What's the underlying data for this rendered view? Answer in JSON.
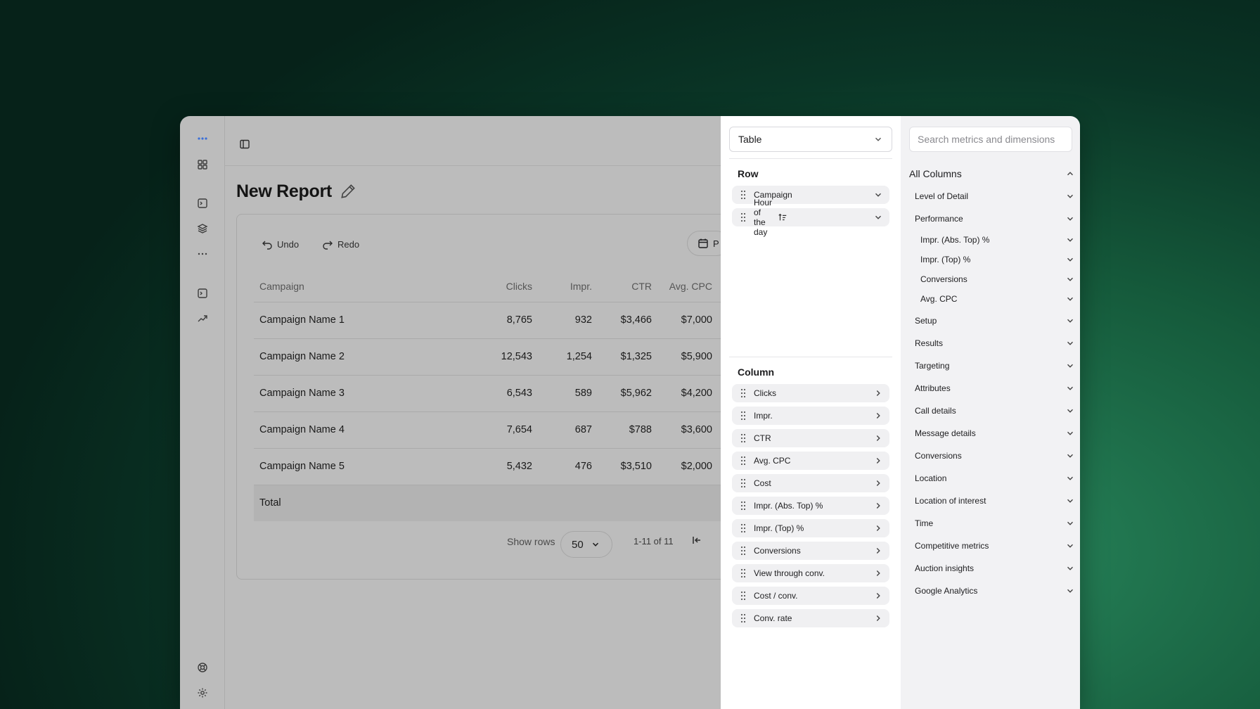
{
  "page": {
    "title": "New Report"
  },
  "toolbar": {
    "undo_label": "Undo",
    "redo_label": "Redo",
    "date_label": "P"
  },
  "table": {
    "headers": [
      "Campaign",
      "Clicks",
      "Impr.",
      "CTR",
      "Avg. CPC"
    ],
    "rows": [
      [
        "Campaign Name 1",
        "8,765",
        "932",
        "$3,466",
        "$7,000"
      ],
      [
        "Campaign Name 2",
        "12,543",
        "1,254",
        "$1,325",
        "$5,900"
      ],
      [
        "Campaign Name 3",
        "6,543",
        "589",
        "$5,962",
        "$4,200"
      ],
      [
        "Campaign Name 4",
        "7,654",
        "687",
        "$788",
        "$3,600"
      ],
      [
        "Campaign Name 5",
        "5,432",
        "476",
        "$3,510",
        "$2,000"
      ]
    ],
    "total_label": "Total"
  },
  "pagination": {
    "show_rows_label": "Show rows",
    "rows_value": "50",
    "range_text": "1-11 of 11"
  },
  "config": {
    "chart_type": "Table",
    "row_section_title": "Row",
    "row_items": [
      "Campaign",
      "Hour of the day"
    ],
    "column_section_title": "Column",
    "column_items": [
      "Clicks",
      "Impr.",
      "CTR",
      "Avg. CPC",
      "Cost",
      "Impr. (Abs. Top) %",
      "Impr. (Top) %",
      "Conversions",
      "View through conv.",
      "Cost / conv.",
      "Conv. rate"
    ]
  },
  "columns_panel": {
    "search_placeholder": "Search metrics and dimensions",
    "root_label": "All Columns",
    "groups": [
      "Level of Detail",
      "Performance"
    ],
    "performance_children": [
      "Impr. (Abs. Top) %",
      "Impr. (Top) %",
      "Conversions",
      "Avg. CPC"
    ],
    "more_groups": [
      "Setup",
      "Results",
      "Targeting",
      "Attributes",
      "Call details",
      "Message details",
      "Conversions",
      "Location",
      "Location of interest",
      "Time",
      "Competitive metrics",
      "Auction insights",
      "Google Analytics"
    ]
  },
  "colors": {
    "overlay": "#bcbcbc",
    "config_bg": "#ffffff",
    "columns_bg": "#f2f2f4",
    "background_green": "#1a6b47"
  }
}
